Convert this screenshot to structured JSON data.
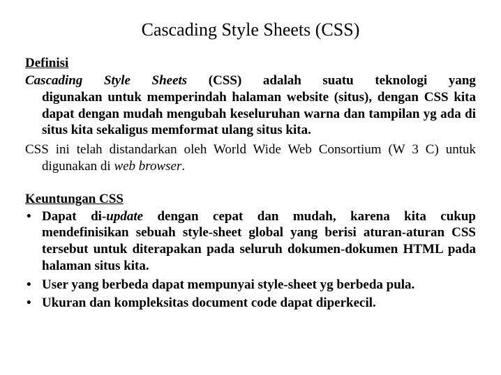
{
  "title": "Cascading Style Sheets (CSS)",
  "section1": {
    "heading": "Definisi",
    "p1_tokens": {
      "t1": "Cascading",
      "t2": "Style",
      "t3": "Sheets",
      "t4": "(CSS)",
      "t5": "adalah",
      "t6": "suatu",
      "t7": "teknologi",
      "t8": "yang"
    },
    "p1_rest": "digunakan untuk memperindah halaman website (situs), dengan CSS kita dapat dengan mudah mengubah keseluruhan warna dan tampilan yg ada di situs kita sekaligus memformat ulang situs kita.",
    "p2_a": "CSS ini telah distandarkan oleh World Wide Web Consortium (W 3 C) untuk digunakan di ",
    "p2_b": "web browser",
    "p2_c": "."
  },
  "section2": {
    "heading": "Keuntungan CSS",
    "b1_a": "Dapat di-",
    "b1_b": "update",
    "b1_c": " dengan cepat dan mudah, karena kita cukup mendefinisikan sebuah style-sheet global yang berisi aturan-aturan CSS tersebut untuk diterapakan pada seluruh dokumen-dokumen HTML pada halaman situs kita.",
    "b2": "User yang berbeda dapat mempunyai style-sheet yg berbeda pula.",
    "b3": "Ukuran dan kompleksitas document code dapat diperkecil."
  }
}
